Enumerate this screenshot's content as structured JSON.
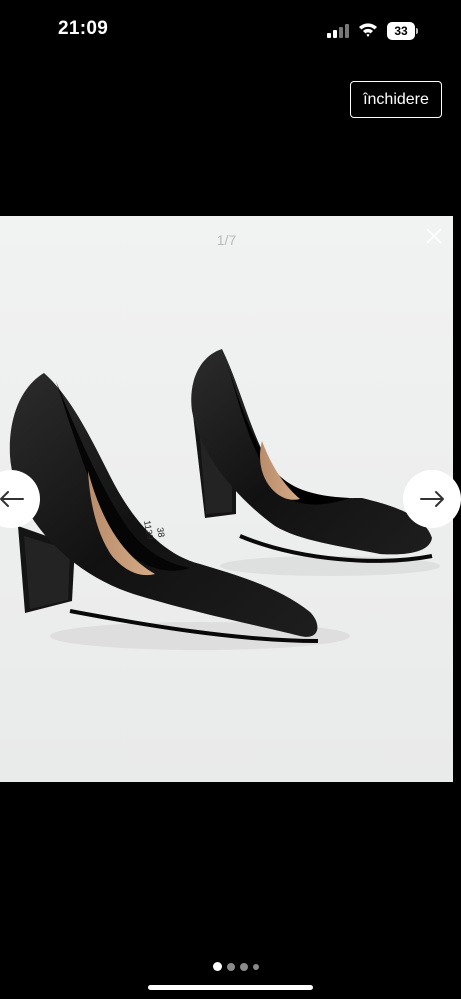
{
  "status_bar": {
    "time": "21:09",
    "battery_level": "33"
  },
  "header": {
    "close_label": "închidere"
  },
  "gallery": {
    "counter": "1/7",
    "image_subject": "black satin pointed-toe block-heel pumps",
    "insole_text_1": "1139",
    "insole_text_2": "38",
    "prev_icon": "arrow-left-icon",
    "next_icon": "arrow-right-icon"
  },
  "pagination": {
    "dot_count": 4,
    "active_index": 0
  },
  "colors": {
    "background": "#000000",
    "gallery_background": "#eff0f0",
    "accent": "#ffffff"
  }
}
